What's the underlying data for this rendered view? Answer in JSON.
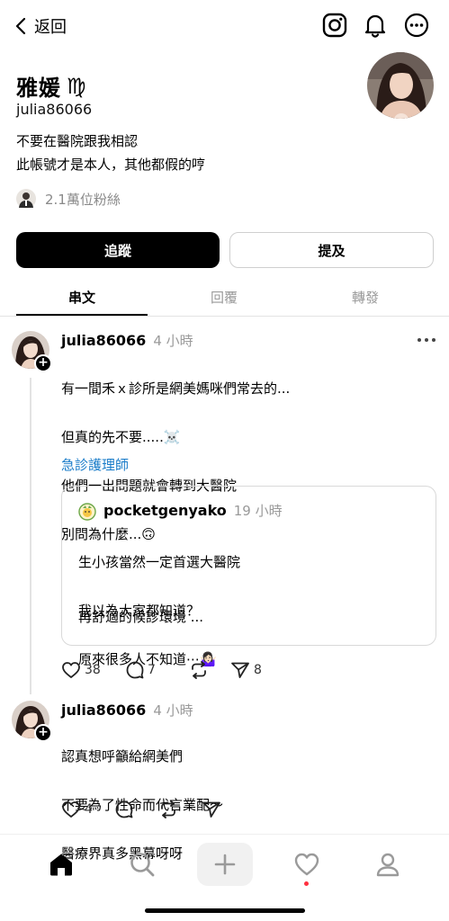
{
  "topbar": {
    "back_label": "返回",
    "icons": [
      "instagram-icon",
      "bell-icon",
      "more-circle-icon"
    ]
  },
  "profile": {
    "name": "雅媛",
    "zodiac": "♍",
    "handle": "julia86066",
    "bio_line1": "不要在醫院跟我相認",
    "bio_line2": "此帳號才是本人，其他都假的哼",
    "followers": "2.1萬位粉絲"
  },
  "buttons": {
    "follow": "追蹤",
    "mention": "提及"
  },
  "tabs": [
    {
      "label": "串文",
      "active": true
    },
    {
      "label": "回覆",
      "active": false
    },
    {
      "label": "轉發",
      "active": false
    }
  ],
  "posts": [
    {
      "user": "julia86066",
      "time": "4 小時",
      "line1": "有一間禾ｘ診所是網美媽咪們常去的...",
      "line2": "但真的先不要.....☠️",
      "line3": "他們一出問題就會轉到大醫院",
      "line4": "別問為什麼...🙃",
      "tag": "急診護理師",
      "quote": {
        "user": "pocketgenyako",
        "time": "19 小時",
        "line1": "生小孩當然一定首選大醫院",
        "line2": "我以為大家都知道？",
        "line3": "原來很多人不知道⋯🤷🏻‍♀️",
        "line4": "再舒適的候診環境 ..."
      },
      "likes": "38",
      "comments": "7",
      "reposts": "",
      "shares": "8"
    },
    {
      "user": "julia86066",
      "time": "4 小時",
      "line1": "認真想呼籲給網美們",
      "line2": "不要為了性命而代言業配～",
      "line3": "醫療界真多黑幕呀呀",
      "likes": "4",
      "comments": "",
      "reposts": "",
      "shares": ""
    }
  ],
  "nav": [
    "home-icon",
    "search-icon",
    "plus-icon",
    "heart-icon",
    "profile-icon"
  ],
  "colors": {
    "link": "#1a7cc9",
    "muted": "#9a9a9a",
    "notif_dot": "#ff3040"
  }
}
